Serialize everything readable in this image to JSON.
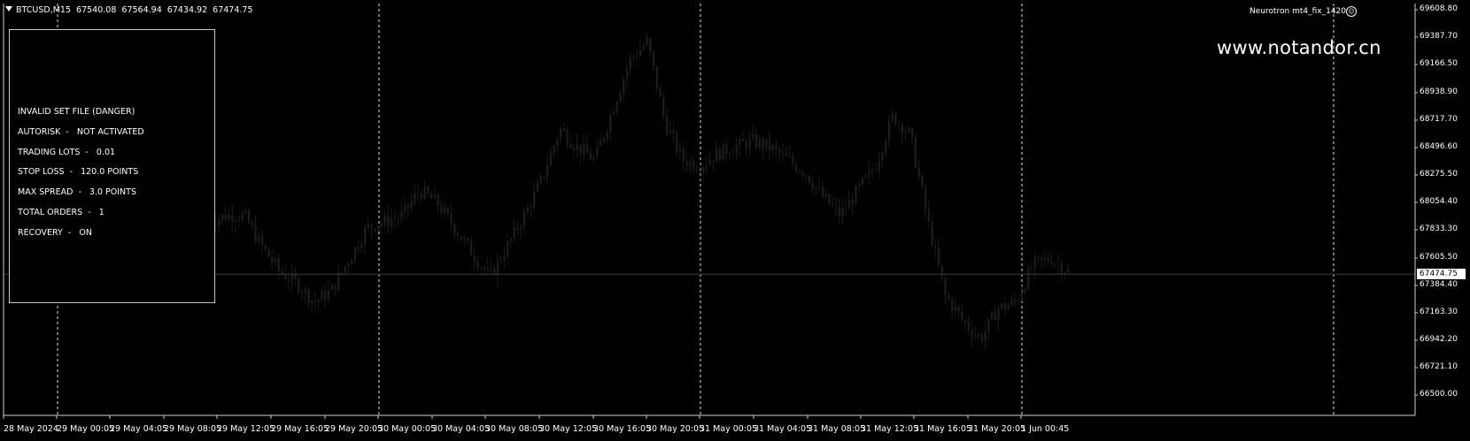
{
  "header": {
    "symbol": "BTCUSD,M15",
    "open": "67540.08",
    "high": "67564.94",
    "low": "67434.92",
    "close": "67474.75"
  },
  "expert": {
    "name": "Neurotron mt4_fix_1420",
    "icon": "smiley-icon"
  },
  "watermark": "www.notandor.cn",
  "info_panel": [
    "INVALID SET FILE (DANGER)",
    "AUTORISK  -   NOT ACTIVATED",
    "TRADING LOTS  -   0.01",
    "STOP LOSS  -   120.0 POINTS",
    "MAX SPREAD  -   3.0 POINTS",
    "TOTAL ORDERS  -   1",
    "RECOVERY  -   ON"
  ],
  "price_axis": {
    "ticks": [
      "69608.80",
      "69387.70",
      "69166.50",
      "68938.90",
      "68717.70",
      "68496.60",
      "68275.50",
      "68054.40",
      "67833.30",
      "67605.50",
      "67384.40",
      "67163.30",
      "66942.20",
      "66721.10",
      "66500.00"
    ],
    "current": "67474.75"
  },
  "time_axis": {
    "ticks": [
      "28 May 2024",
      "29 May 00:05",
      "29 May 04:05",
      "29 May 08:05",
      "29 May 12:05",
      "29 May 16:05",
      "29 May 20:05",
      "30 May 00:05",
      "30 May 04:05",
      "30 May 08:05",
      "30 May 12:05",
      "30 May 16:05",
      "30 May 20:05",
      "31 May 00:05",
      "31 May 04:05",
      "31 May 08:05",
      "31 May 12:05",
      "31 May 16:05",
      "31 May 20:05",
      "1 Jun 00:45"
    ]
  },
  "chart_data": {
    "type": "candlestick",
    "symbol": "BTCUSD",
    "timeframe": "M15",
    "ylim": [
      66500.0,
      69608.8
    ],
    "current_price": 67474.75,
    "day_separators": [
      "29 May 00:05",
      "30 May 00:05",
      "31 May 00:05",
      "1 Jun 00:45"
    ],
    "approx_close_path": [
      67900,
      67950,
      67950,
      67700,
      67500,
      67400,
      67250,
      67350,
      67600,
      67850,
      67900,
      67950,
      68150,
      68050,
      67850,
      67650,
      67450,
      67700,
      67950,
      68250,
      68650,
      68500,
      68400,
      68800,
      69200,
      69350,
      68700,
      68400,
      68350,
      68450,
      68500,
      68550,
      68500,
      68400,
      68300,
      68100,
      67950,
      68150,
      68350,
      68750,
      68600,
      67900,
      67300,
      67100,
      66950,
      67200,
      67250,
      67550,
      67600,
      67500
    ],
    "colors": {
      "background": "#000000",
      "grid": "#ffffff",
      "candle": "#1c1c1c"
    }
  }
}
